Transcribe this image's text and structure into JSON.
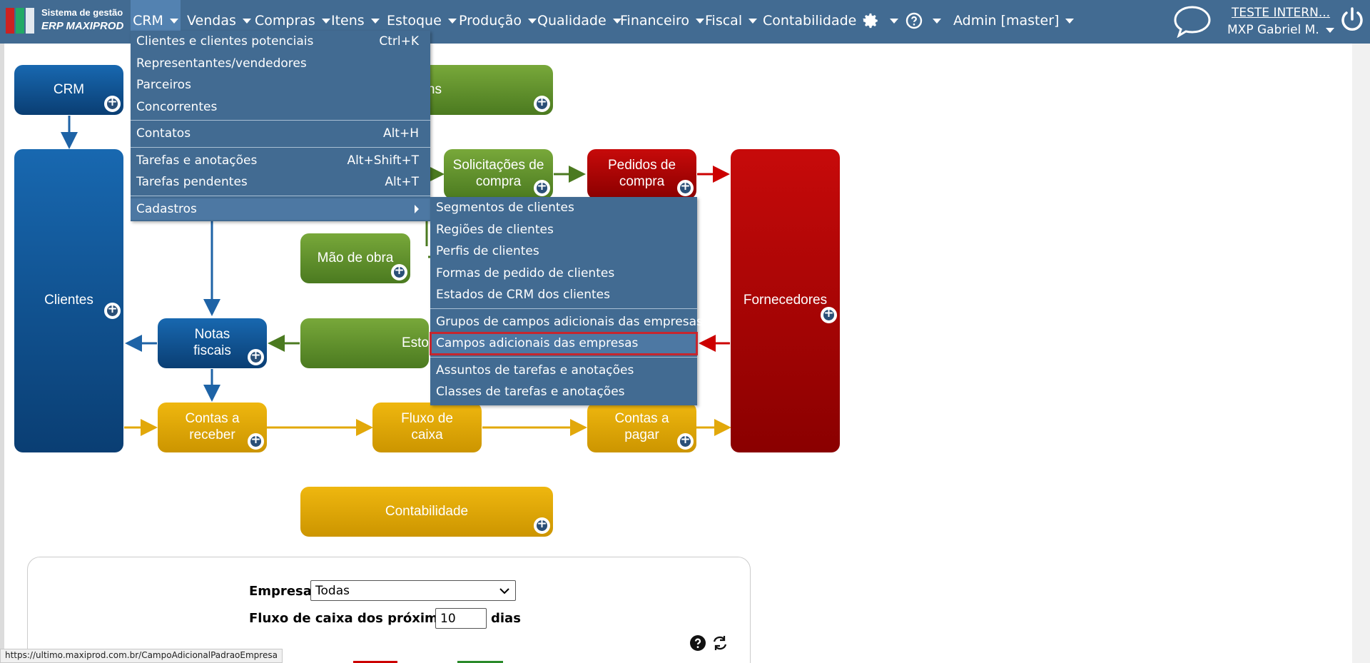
{
  "logo": {
    "line1": "Sistema de gestão",
    "line2": "ERP MAXIPROD"
  },
  "nav": [
    {
      "label": "CRM",
      "active": true
    },
    {
      "label": "Vendas"
    },
    {
      "label": "Compras"
    },
    {
      "label": "Itens"
    },
    {
      "label": "Estoque"
    },
    {
      "label": "Produção"
    },
    {
      "label": "Qualidade"
    },
    {
      "label": "Financeiro"
    },
    {
      "label": "Fiscal"
    },
    {
      "label": "Contabilidade"
    },
    {
      "label": "Admin [master]"
    }
  ],
  "header": {
    "company": "TESTE INTERN...",
    "user": "MXP Gabriel M."
  },
  "diagram": {
    "crm": "CRM",
    "hidden_green": "ns",
    "solicitacoes": "Solicitações de compra",
    "pedidos": "Pedidos de compra",
    "mao_obra": "Mão de obra",
    "clientes": "Clientes",
    "fornecedores": "Fornecedores",
    "notas": "Notas fiscais",
    "estoque_partial": "Esto",
    "contas_receber": "Contas a receber",
    "fluxo": "Fluxo de caixa",
    "contas_pagar": "Contas a pagar",
    "contabilidade": "Contabilidade"
  },
  "crm_menu": [
    {
      "label": "Clientes e clientes potenciais",
      "shortcut": "Ctrl+K"
    },
    {
      "label": "Representantes/vendedores",
      "shortcut": ""
    },
    {
      "label": "Parceiros",
      "shortcut": ""
    },
    {
      "label": "Concorrentes",
      "shortcut": ""
    },
    {
      "label": "Contatos",
      "shortcut": "Alt+H"
    },
    {
      "label": "Tarefas e anotações",
      "shortcut": "Alt+Shift+T"
    },
    {
      "label": "Tarefas pendentes",
      "shortcut": "Alt+T"
    },
    {
      "label": "Cadastros",
      "shortcut": ""
    }
  ],
  "cadastros_menu": [
    "Segmentos de clientes",
    "Regiões de clientes",
    "Perfis de clientes",
    "Formas de pedido de clientes",
    "Estados de CRM dos clientes",
    "Grupos de campos adicionais das empresas",
    "Campos adicionais das empresas",
    "Assuntos de tarefas e anotações",
    "Classes de tarefas e anotações"
  ],
  "panel": {
    "empresa_label": "Empresa",
    "empresa_value": "Todas",
    "fluxo_label": "Fluxo de caixa dos próximos",
    "fluxo_value": "10",
    "fluxo_unit": "dias"
  },
  "status_url": "https://ultimo.maxiprod.com.br/CampoAdicionalPadraoEmpresa",
  "colors": {
    "topbar": "#426b92",
    "highlight": "#c6262e"
  }
}
